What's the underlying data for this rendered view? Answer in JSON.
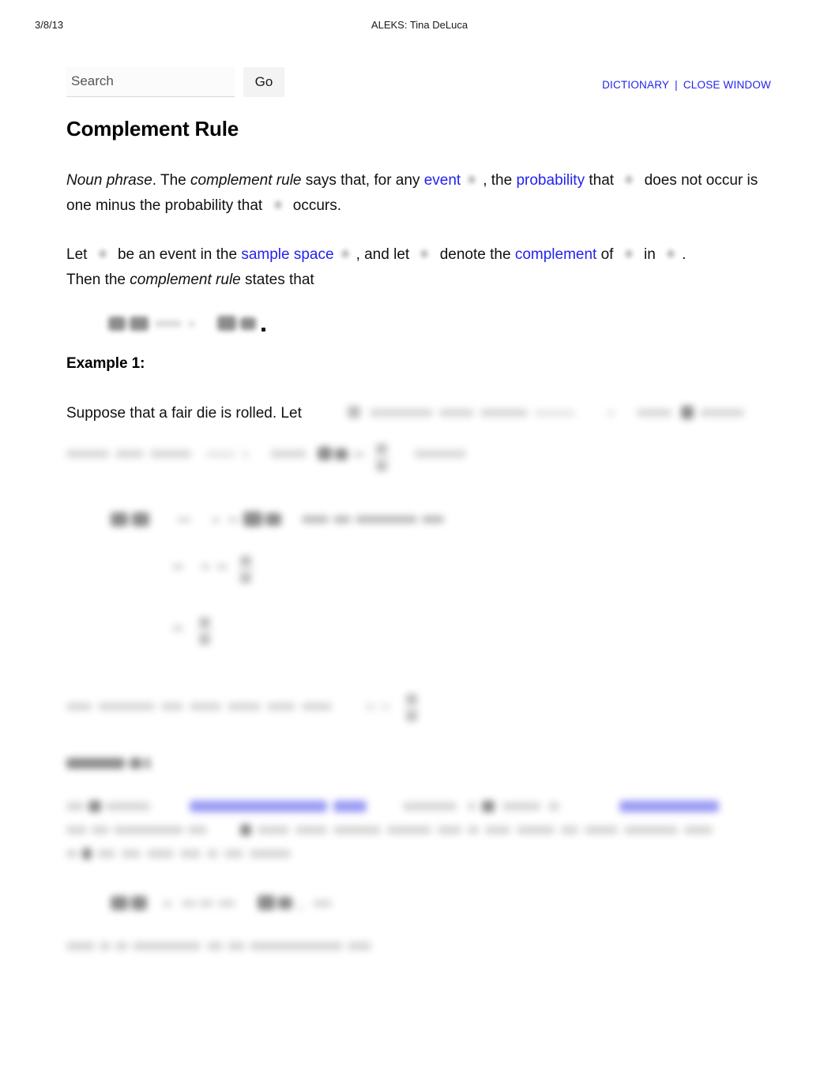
{
  "print_header": {
    "date": "3/8/13",
    "document_title": "ALEKS: Tina DeLuca"
  },
  "search": {
    "placeholder": "Search",
    "value": "",
    "go_label": "Go"
  },
  "top_links": {
    "dictionary_label": "DICTIONARY",
    "separator": "|",
    "close_window_label": "CLOSE WINDOW",
    "link_color": "#2323ee"
  },
  "article": {
    "title": "Complement Rule",
    "definition": {
      "part_of_speech": "Noun phrase",
      "after_pos": ". The ",
      "term_italic": "complement rule",
      "text_1": " says that, for any ",
      "link_event": "event",
      "text_2": ", the ",
      "link_probability": "probability",
      "text_3": " that ",
      "text_4": " does not occur is one minus the probability that ",
      "text_5": " occurs."
    },
    "setup": {
      "text_1": "Let ",
      "text_2": " be an event in the ",
      "link_sample_space": "sample space",
      "text_3": ", and let ",
      "text_4": " denote the ",
      "link_complement": "complement",
      "text_5": " of ",
      "text_6": " in ",
      "text_7": ".",
      "text_8": "Then the ",
      "term_italic": "complement rule",
      "text_9": " states that"
    },
    "example_1": {
      "heading": "Example 1:",
      "text_1": "Suppose that a fair die is rolled. Let "
    },
    "example_2": {
      "heading": "Example 2:"
    }
  },
  "colors": {
    "link_blue": "#2323ee",
    "text_black": "#111111",
    "page_background": "#ffffff"
  }
}
